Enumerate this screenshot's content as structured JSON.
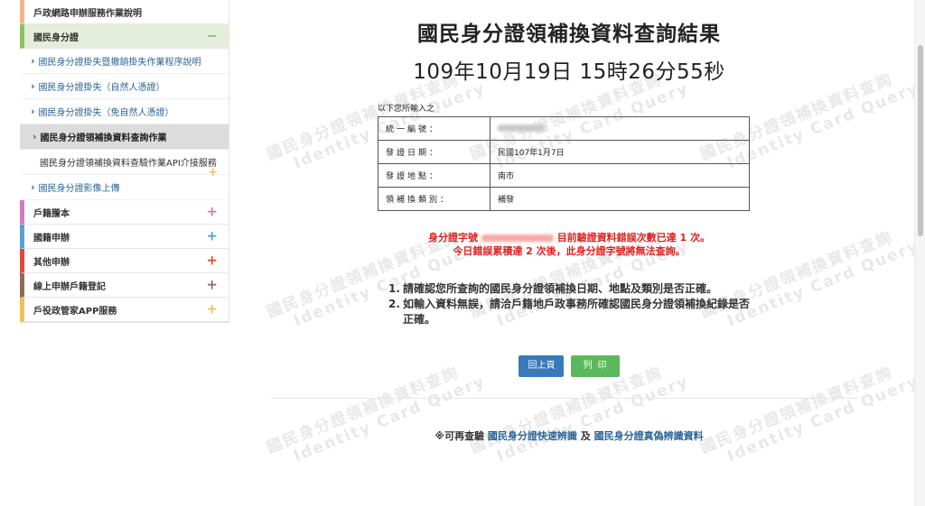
{
  "sidebar": {
    "top_item": "戶政網路申辦服務作業說明",
    "open_section": {
      "label": "國民身分證",
      "toggle": "−"
    },
    "sub_items": [
      "國民身分證掛失暨撤銷掛失作業程序說明",
      "國民身分證掛失（自然人憑證）",
      "國民身分證掛失（免自然人憑證）",
      "國民身分證領補換資料查詢作業"
    ],
    "deep_item": "國民身分證領補換資料查驗作業API介接服務",
    "upload_item": "國民身分證影像上傳",
    "sections": [
      {
        "label": "戶籍謄本",
        "plus": "+"
      },
      {
        "label": "國籍申辦",
        "plus": "+"
      },
      {
        "label": "其他申辦",
        "plus": "+"
      },
      {
        "label": "線上申辦戶籍登記",
        "plus": "+"
      },
      {
        "label": "戶役政管家APP服務",
        "plus": "+"
      }
    ],
    "colors": {
      "top": "#f6b38d",
      "open": "#8cc063",
      "deep_plus": "#f0c060",
      "sec0": "#d07ac0",
      "sec1": "#5aa0d8",
      "sec2": "#e04b3a",
      "sec3": "#8d6e5a",
      "sec4": "#f0c060"
    }
  },
  "main": {
    "title": "國民身分證領補換資料查詢結果",
    "datetime": "109年10月19日 15時26分55秒",
    "input_hint": "以下您所輸入之",
    "table": [
      {
        "label": "統一編號：",
        "value": ""
      },
      {
        "label": "發證日期：",
        "value": "民國107年1月7日"
      },
      {
        "label": "發證地點：",
        "value": "南市"
      },
      {
        "label": "領補換類別：",
        "value": "補發"
      }
    ],
    "warning": {
      "prefix": "身分證字號",
      "suffix": "目前驗證資料錯誤次數已達 1 次。",
      "line2": "今日錯誤累積達 2 次後，此身分證字號將無法查詢。"
    },
    "notes": [
      {
        "num": "1.",
        "text": "請確認您所查詢的國民身分證領補換日期、地點及類別是否正確。"
      },
      {
        "num": "2.",
        "text": "如輸入資料無誤，請洽戶籍地戶政事務所確認國民身分證領補換紀錄是否正確。"
      }
    ],
    "buttons": {
      "back": "回上頁",
      "print": "列印"
    },
    "footer": {
      "prefix": "※可再查驗",
      "link1": "國民身分證快速辨識",
      "join": "及",
      "link2": "國民身分證真偽辨識資料"
    }
  },
  "watermark": {
    "zh": "國民身分證領補換資料查詢",
    "en": "Identity Card Query"
  }
}
